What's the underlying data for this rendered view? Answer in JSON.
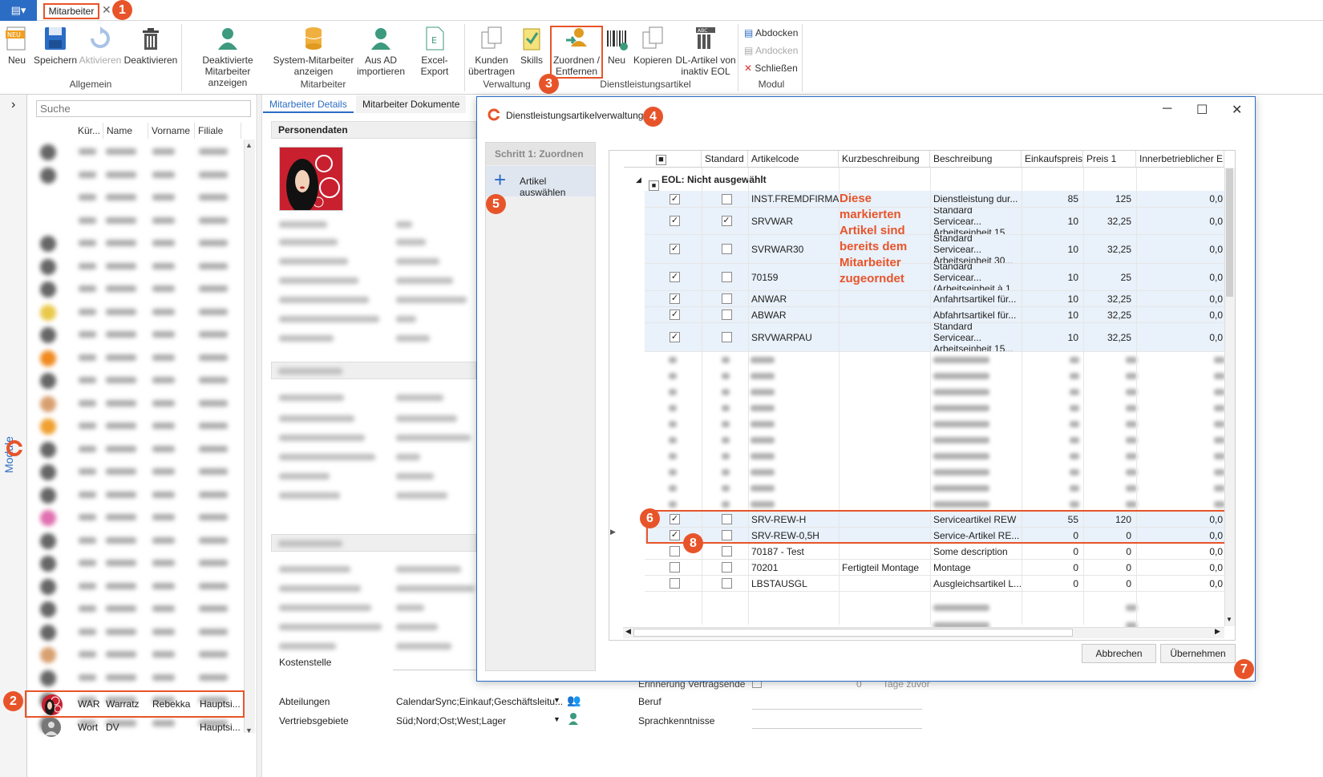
{
  "topbar": {
    "app_menu_glyph": "▤▾",
    "doc_tab": "Mitarbeiter",
    "close_glyph": "✕"
  },
  "ribbon": {
    "allgemein": {
      "neu": "Neu",
      "speichern": "Speichern",
      "aktivieren": "Aktivieren",
      "deaktivieren": "Deaktivieren",
      "group": "Allgemein"
    },
    "mitarbeiter": {
      "deakt_line1": "Deaktivierte",
      "deakt_line2": "Mitarbeiter anzeigen",
      "sys_line1": "System-Mitarbeiter",
      "sys_line2": "anzeigen",
      "ad_line1": "Aus AD",
      "ad_line2": "importieren",
      "excel": "Excel-Export",
      "group": "Mitarbeiter"
    },
    "verwaltung": {
      "kunden_line1": "Kunden",
      "kunden_line2": "übertragen",
      "skills": "Skills",
      "zuordnen_line1": "Zuordnen /",
      "zuordnen_line2": "Entfernen",
      "group": "Verwaltung"
    },
    "dl": {
      "neu": "Neu",
      "kopieren": "Kopieren",
      "dlart_line1": "DL-Artikel von",
      "dlart_line2": "inaktiv EOL",
      "group": "Dienstleistungsartikel"
    },
    "modul": {
      "abdocken": "Abdocken",
      "andocken": "Andocken",
      "schliessen": "Schließen",
      "group": "Modul"
    }
  },
  "rail": {
    "label": "Module",
    "expand_glyph": "›"
  },
  "list": {
    "search_placeholder": "Suche",
    "columns": [
      "Kür...",
      "Name",
      "Vorname",
      "Filiale"
    ],
    "selected": {
      "kurz": "WAR",
      "name": "Warratz",
      "vorname": "Rebekka",
      "filiale": "Hauptsi..."
    },
    "last": {
      "kurz": "Wort",
      "name": "DV",
      "vorname": "",
      "filiale": "Hauptsi..."
    }
  },
  "detail": {
    "tabs": [
      "Mitarbeiter Details",
      "Mitarbeiter Dokumente"
    ],
    "section_personendaten": "Personendaten",
    "kostenstelle_label": "Kostenstelle",
    "abteilungen_label": "Abteilungen",
    "abteilungen_value": "CalendarSync;Einkauf;Geschäftsleitu...",
    "vertriebsgebiete_label": "Vertriebsgebiete",
    "vertriebsgebiete_value": "Süd;Nord;Ost;West;Lager",
    "erinnerung_label": "Erinnerung Vertragsende",
    "erinnerung_value": "0",
    "tage_zuvor": "Tage zuvor",
    "beruf_label": "Beruf",
    "sprach_label": "Sprachkenntnisse"
  },
  "dialog": {
    "title": "Dienstleistungsartikelverwaltung",
    "step_header": "Schritt 1: Zuordnen",
    "step_item": "Artikel auswählen",
    "columns": [
      "Standard",
      "Artikelcode",
      "Kurzbeschreibung",
      "Beschreibung",
      "Einkaufspreis",
      "Preis 1",
      "Innerbetrieblicher EK"
    ],
    "group_label": "EOL: Nicht ausgewählt",
    "annotation": "Diese markierten Artikel sind bereits dem Mitarbeiter zugeorndet",
    "rows_top": [
      {
        "code": "INST.FREMDFIRMA",
        "kurz": "",
        "b1": "Dienstleistung dur...",
        "b2": "",
        "ek": "85",
        "p1": "125",
        "ibek": "0,0",
        "checked": "✓",
        "standard": ""
      },
      {
        "code": "SRVWAR",
        "kurz": "",
        "b1": "Standard Servicear...",
        "b2": "Arbeitseinheit 15...",
        "ek": "10",
        "p1": "32,25",
        "ibek": "0,0",
        "checked": "✓",
        "standard": "✓"
      },
      {
        "code": "SVRWAR30",
        "kurz": "",
        "b1": "Standard Servicear...",
        "b2": "Arbeitseinheit 30...",
        "ek": "10",
        "p1": "32,25",
        "ibek": "0,0",
        "checked": "✓",
        "standard": ""
      },
      {
        "code": "70159",
        "kurz": "",
        "b1": "Standard Servicear...",
        "b2": "(Arbeitseinheit à 1...",
        "ek": "10",
        "p1": "25",
        "ibek": "0,0",
        "checked": "✓",
        "standard": ""
      },
      {
        "code": "ANWAR",
        "kurz": "",
        "b1": "Anfahrtsartikel für...",
        "b2": "",
        "ek": "10",
        "p1": "32,25",
        "ibek": "0,0",
        "checked": "✓",
        "standard": ""
      },
      {
        "code": "ABWAR",
        "kurz": "",
        "b1": "Abfahrtsartikel für...",
        "b2": "",
        "ek": "10",
        "p1": "32,25",
        "ibek": "0,0",
        "checked": "✓",
        "standard": ""
      },
      {
        "code": "SRVWARPAU",
        "kurz": "",
        "b1": "Standard Servicear...",
        "b2": "Arbeitseinheit 15...",
        "ek": "10",
        "p1": "32,25",
        "ibek": "0,0",
        "checked": "✓",
        "standard": ""
      }
    ],
    "rows_bottom": [
      {
        "code": "SRV-REW-H",
        "kurz": "",
        "b1": "Serviceartikel REW",
        "ek": "55",
        "p1": "120",
        "ibek": "0,0",
        "checked": "✓",
        "standard": ""
      },
      {
        "code": "SRV-REW-0,5H",
        "kurz": "",
        "b1": "Service-Artikel RE...",
        "ek": "0",
        "p1": "0",
        "ibek": "0,0",
        "checked": "✓",
        "standard": ""
      },
      {
        "code": "70187 - Test",
        "kurz": "",
        "b1": "Some description",
        "ek": "0",
        "p1": "0",
        "ibek": "0,0",
        "checked": "",
        "standard": ""
      },
      {
        "code": "70201",
        "kurz": "Fertigteil Montage",
        "b1": "Montage",
        "ek": "0",
        "p1": "0",
        "ibek": "0,0",
        "checked": "",
        "standard": ""
      },
      {
        "code": "LBSTAUSGL",
        "kurz": "",
        "b1": "Ausgleichsartikel L...",
        "ek": "0",
        "p1": "0",
        "ibek": "0,0",
        "checked": "",
        "standard": ""
      }
    ],
    "btn_cancel": "Abbrechen",
    "btn_apply": "Übernehmen"
  },
  "badges": [
    "1",
    "2",
    "3",
    "4",
    "5",
    "6",
    "7",
    "8"
  ],
  "colors": {
    "accent": "#2b6cc4",
    "highlight": "#e8542a",
    "selected_row": "#e9f1fa"
  }
}
